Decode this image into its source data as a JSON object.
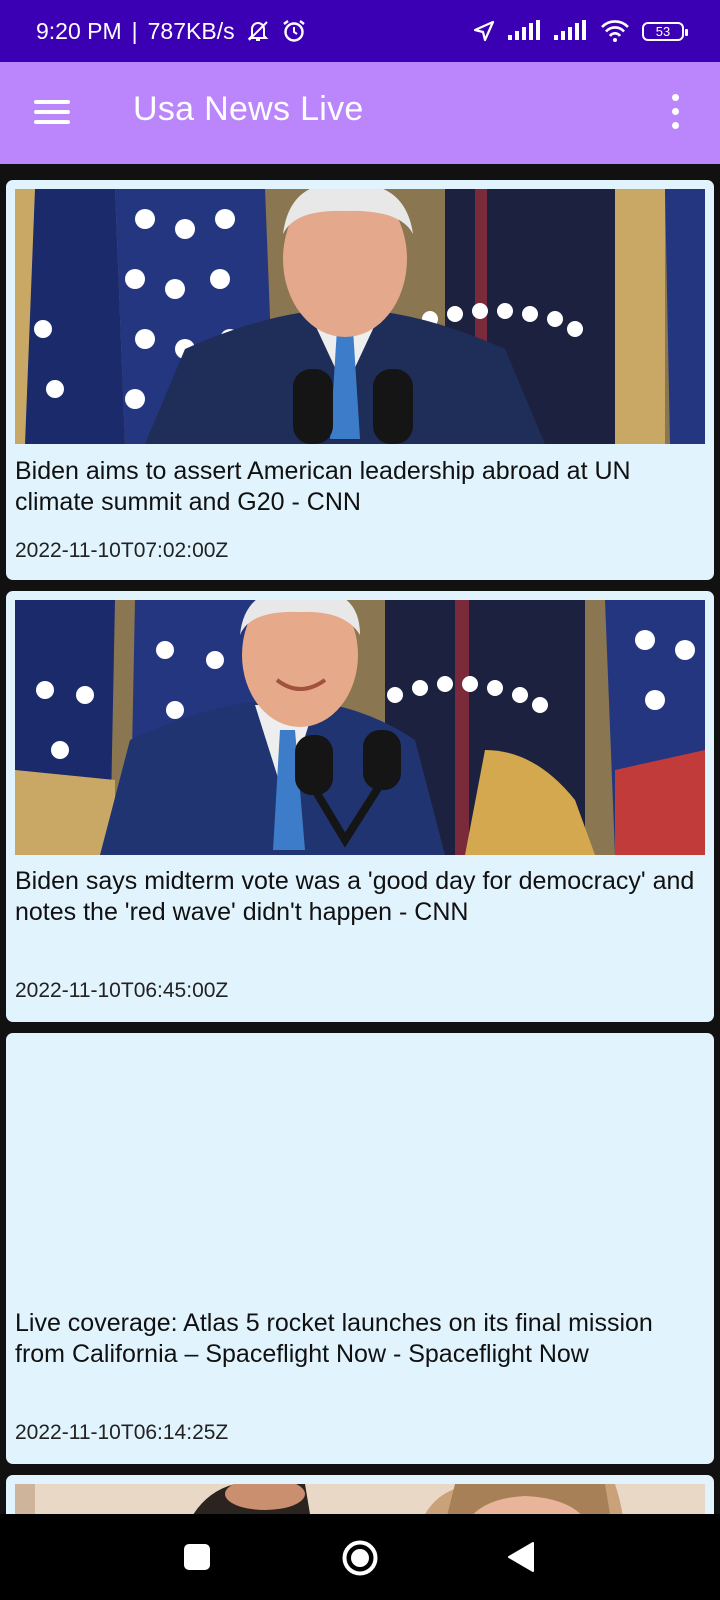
{
  "status_bar": {
    "time": "9:20 PM",
    "separator": "|",
    "speed": "787KB/s",
    "battery": "53",
    "icons": [
      "mute-icon",
      "alarm-icon",
      "location-icon",
      "signal-icon",
      "signal-icon",
      "wifi-icon",
      "battery-icon"
    ]
  },
  "app_bar": {
    "title": "Usa News Live",
    "left_icon": "menu-icon",
    "right_icon": "more-vert-icon"
  },
  "articles": [
    {
      "title": "Biden aims to assert American leadership abroad at UN climate summit and G20 - CNN",
      "date": "2022-11-10T07:02:00Z",
      "has_image": true
    },
    {
      "title": "Biden says midterm vote was a 'good day for democracy' and notes the 'red wave' didn't happen - CNN",
      "date": "2022-11-10T06:45:00Z",
      "has_image": true
    },
    {
      "title": "Live coverage: Atlas 5 rocket launches on its final mission from California – Spaceflight Now - Spaceflight Now",
      "date": "2022-11-10T06:14:25Z",
      "has_image": false
    }
  ],
  "nav_bar": {
    "buttons": [
      "recents-icon",
      "home-icon",
      "back-icon"
    ]
  },
  "colors": {
    "status_bar": "#3b00b3",
    "app_bar": "#bb86fc",
    "card_background": "#e1f3fd",
    "page_background": "#111111"
  }
}
